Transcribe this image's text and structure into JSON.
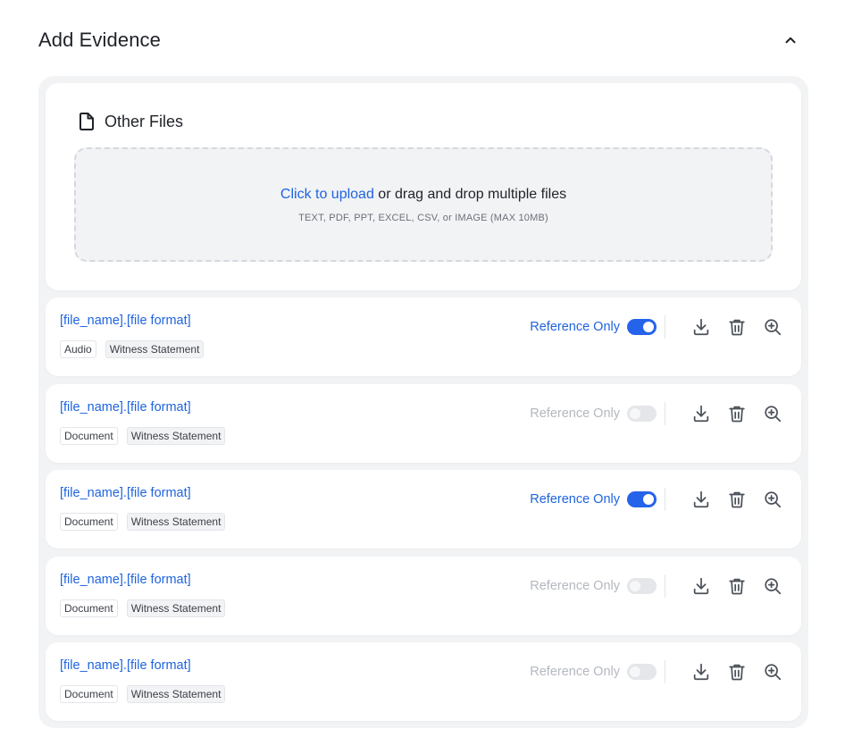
{
  "header": {
    "title": "Add Evidence"
  },
  "upload": {
    "title": "Other Files",
    "link_text": "Click to upload",
    "rest_text": " or drag and drop multiple files",
    "hint": "TEXT, PDF, PPT, EXCEL, CSV, or IMAGE (MAX 10MB)"
  },
  "files": [
    {
      "name": "[file_name].[file format]",
      "tags": [
        "Audio",
        "Witness Statement"
      ],
      "reference_label": "Reference Only",
      "reference_on": true
    },
    {
      "name": "[file_name].[file format]",
      "tags": [
        "Document",
        "Witness Statement"
      ],
      "reference_label": "Reference Only",
      "reference_on": false
    },
    {
      "name": "[file_name].[file format]",
      "tags": [
        "Document",
        "Witness Statement"
      ],
      "reference_label": "Reference Only",
      "reference_on": true
    },
    {
      "name": "[file_name].[file format]",
      "tags": [
        "Document",
        "Witness Statement"
      ],
      "reference_label": "Reference Only",
      "reference_on": false
    },
    {
      "name": "[file_name].[file format]",
      "tags": [
        "Document",
        "Witness Statement"
      ],
      "reference_label": "Reference Only",
      "reference_on": false
    }
  ],
  "icons": {
    "collapse": "chevron-up-icon",
    "file": "file-icon",
    "download": "download-icon",
    "delete": "trash-icon",
    "zoom": "zoom-in-icon"
  },
  "colors": {
    "accent": "#2563eb",
    "link": "#1f64e0",
    "muted": "#b4b8bf",
    "panel": "#f2f3f5"
  }
}
